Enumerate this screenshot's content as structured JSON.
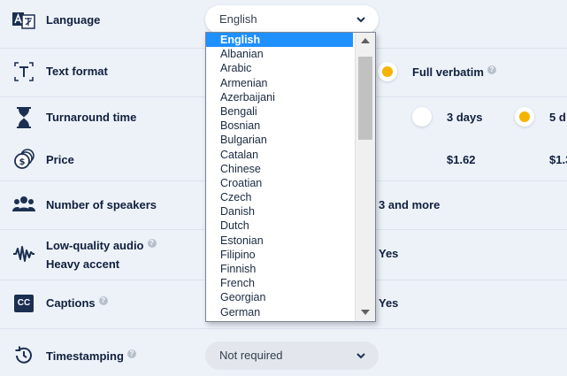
{
  "colors": {
    "accent": "#f5b400",
    "brand_dark": "#0f1f3d",
    "selection": "#1e90ff"
  },
  "rows": {
    "language": {
      "label": "Language",
      "icon": "translate-icon",
      "value": "English"
    },
    "text_format": {
      "label": "Text format",
      "icon": "text-format-icon",
      "option": "Full verbatim"
    },
    "turnaround": {
      "label": "Turnaround time",
      "icon": "hourglass-icon",
      "option_1": "3 days",
      "option_2": "5 d"
    },
    "price": {
      "label": "Price",
      "icon": "coins-icon",
      "price_1": "$1.62",
      "price_2": "$1.3"
    },
    "speakers": {
      "label": "Number of speakers",
      "icon": "people-icon",
      "option": "3 and more"
    },
    "audio": {
      "label": "Low-quality audio",
      "label_2": "Heavy accent",
      "icon": "waveform-icon",
      "option": "Yes"
    },
    "captions": {
      "label": "Captions",
      "icon": "cc-icon",
      "option": "Yes"
    },
    "timestamping": {
      "label": "Timestamping",
      "icon": "clock-history-icon",
      "value": "Not required"
    }
  },
  "help_glyph": "?",
  "cc_text": "CC",
  "language_list": {
    "selected": "English",
    "options": [
      "English",
      "Albanian",
      "Arabic",
      "Armenian",
      "Azerbaijani",
      "Bengali",
      "Bosnian",
      "Bulgarian",
      "Catalan",
      "Chinese",
      "Croatian",
      "Czech",
      "Danish",
      "Dutch",
      "Estonian",
      "Filipino",
      "Finnish",
      "French",
      "Georgian",
      "German"
    ]
  }
}
